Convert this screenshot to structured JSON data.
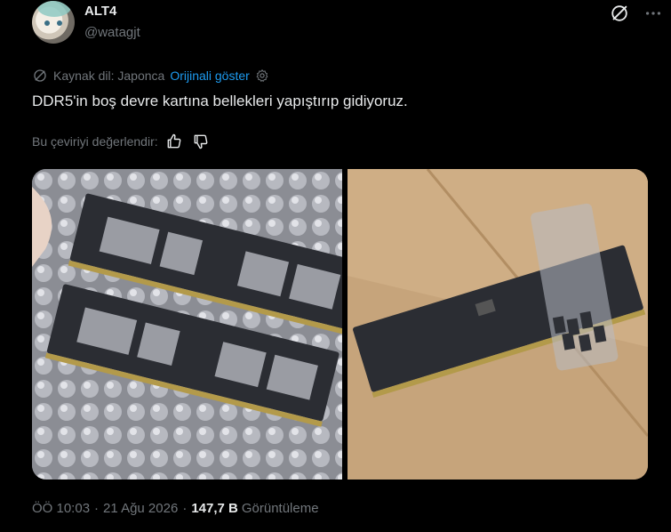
{
  "user": {
    "display_name": "ALT4",
    "handle": "@watagjt"
  },
  "header_icons": [
    "grok-icon",
    "more-icon"
  ],
  "translation": {
    "source_label": "Kaynak dil: Japonca",
    "show_original": "Orijinali göster"
  },
  "tweet": {
    "text": "DDR5'in boş devre kartına bellekleri yapıştırıp gidiyoruz."
  },
  "rate": {
    "label": "Bu çeviriyi değerlendir:"
  },
  "meta": {
    "time": "ÖÖ 10:03",
    "date": "21 Ağu 2026",
    "views_count": "147,7 B",
    "views_label": "Görüntüleme"
  },
  "colors": {
    "background": "#000000",
    "text_primary": "#e7e9ea",
    "text_secondary": "#71767b",
    "accent": "#1d9bf0"
  }
}
